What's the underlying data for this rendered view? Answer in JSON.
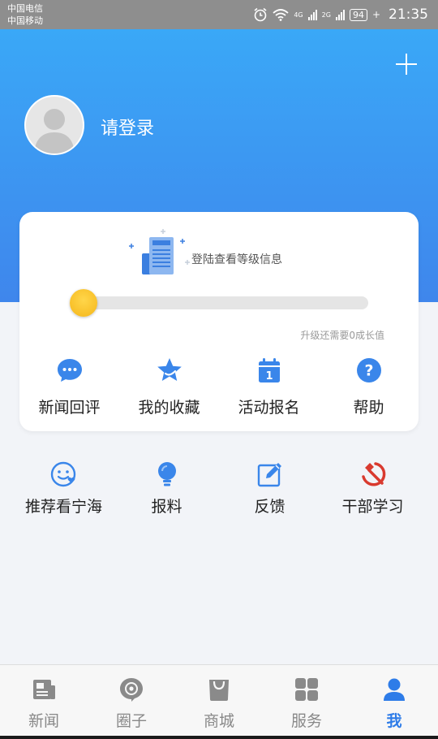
{
  "status_bar": {
    "carrier_1": "中国电信",
    "carrier_2": "中国移动",
    "network_1": "4G",
    "network_2": "2G",
    "battery": "94",
    "time": "21:35"
  },
  "header": {
    "login_label": "请登录",
    "colors": {
      "gradient_top": "#3aa8f7",
      "gradient_bottom": "#3f86ec"
    }
  },
  "level_card": {
    "info": "登陆查看等级信息",
    "progress_fraction": 0.0,
    "upgrade_hint": "升级还需要0成长值",
    "items": [
      {
        "label": "新闻回评",
        "icon": "comment-icon"
      },
      {
        "label": "我的收藏",
        "icon": "star-icon"
      },
      {
        "label": "活动报名",
        "icon": "calendar-icon"
      },
      {
        "label": "帮助",
        "icon": "help-icon"
      }
    ]
  },
  "services": {
    "items": [
      {
        "label": "推荐看宁海",
        "icon": "smile-heart-icon"
      },
      {
        "label": "报料",
        "icon": "lightbulb-icon"
      },
      {
        "label": "反馈",
        "icon": "edit-icon"
      },
      {
        "label": "干部学习",
        "icon": "hammer-sickle-icon"
      }
    ]
  },
  "bottom_nav": {
    "active_index": 4,
    "accent": "#2e7ce8",
    "items": [
      {
        "label": "新闻",
        "icon": "news-icon"
      },
      {
        "label": "圈子",
        "icon": "circle-icon"
      },
      {
        "label": "商城",
        "icon": "shopping-bag-icon"
      },
      {
        "label": "服务",
        "icon": "grid-icon"
      },
      {
        "label": "我",
        "icon": "person-icon"
      }
    ]
  }
}
